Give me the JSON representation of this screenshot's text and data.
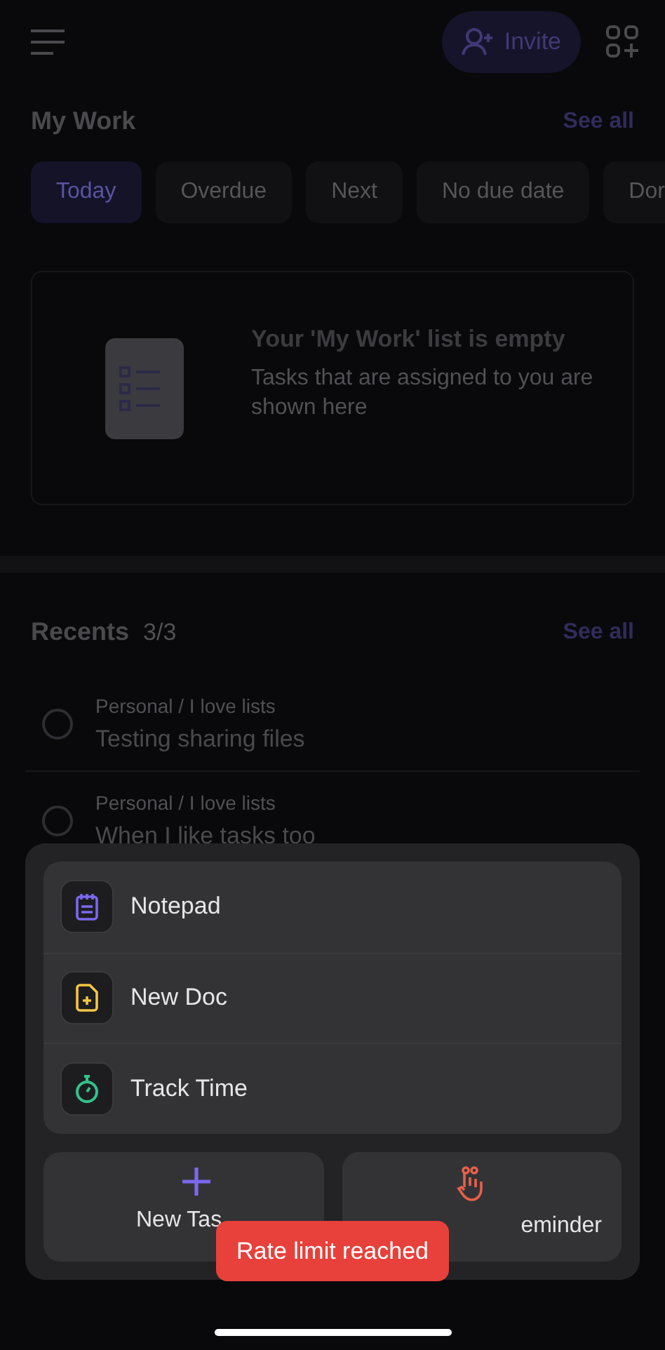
{
  "header": {
    "invite_label": "Invite"
  },
  "my_work": {
    "title": "My Work",
    "see_all": "See all",
    "filters": [
      {
        "label": "Today",
        "selected": true
      },
      {
        "label": "Overdue",
        "selected": false
      },
      {
        "label": "Next",
        "selected": false
      },
      {
        "label": "No due date",
        "selected": false
      },
      {
        "label": "Dor",
        "selected": false
      }
    ],
    "empty_title": "Your 'My Work' list is empty",
    "empty_text": "Tasks that are assigned to you are shown here"
  },
  "recents": {
    "title": "Recents",
    "count": "3/3",
    "see_all": "See all",
    "items": [
      {
        "path": "Personal / I love lists",
        "name": "Testing sharing files",
        "checked": false
      },
      {
        "path": "Personal / I love lists",
        "name": "When I like tasks too",
        "checked": false
      }
    ]
  },
  "sheet": {
    "items": [
      {
        "kind": "notepad",
        "label": "Notepad"
      },
      {
        "kind": "doc",
        "label": "New Doc"
      },
      {
        "kind": "timer",
        "label": "Track Time"
      }
    ],
    "actions": [
      {
        "kind": "task",
        "label": "New Tas"
      },
      {
        "kind": "reminder",
        "label": "eminder"
      }
    ]
  },
  "toast": "Rate limit reached"
}
